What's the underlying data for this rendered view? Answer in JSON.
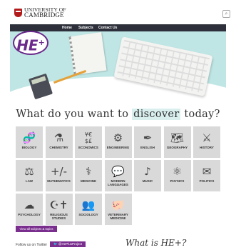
{
  "header": {
    "logo_line1": "UNIVERSITY OF",
    "logo_line2": "CAMBRIDGE",
    "search_icon": "search-icon"
  },
  "nav": {
    "items": [
      "Home",
      "Subjects",
      "Contact Us"
    ]
  },
  "badge": {
    "text": "HE",
    "sup": "+"
  },
  "tagline": {
    "before": "What do you want to",
    "highlight": "discover",
    "after": "today?"
  },
  "subjects": [
    {
      "label": "Biology",
      "icon": "dna-icon",
      "glyph": "🧬"
    },
    {
      "label": "Chemistry",
      "icon": "molecule-icon",
      "glyph": "⚗"
    },
    {
      "label": "Economics",
      "icon": "currency-icon",
      "glyph": "¥€\n$£"
    },
    {
      "label": "Engineering",
      "icon": "gears-icon",
      "glyph": "⚙"
    },
    {
      "label": "English",
      "icon": "book-pen-icon",
      "glyph": "✒"
    },
    {
      "label": "Geography",
      "icon": "world-map-icon",
      "glyph": "🗺"
    },
    {
      "label": "History",
      "icon": "battle-icon",
      "glyph": "⚔"
    },
    {
      "label": "Law",
      "icon": "scales-icon",
      "glyph": "⚖"
    },
    {
      "label": "Mathematics",
      "icon": "plus-minus-icon",
      "glyph": "+/-"
    },
    {
      "label": "Medicine",
      "icon": "stethoscope-icon",
      "glyph": "⚕"
    },
    {
      "label": "Modern Languages",
      "icon": "speech-bubbles-icon",
      "glyph": "💬"
    },
    {
      "label": "Music",
      "icon": "music-note-icon",
      "glyph": "♪"
    },
    {
      "label": "Physics",
      "icon": "atom-icon",
      "glyph": "⚛"
    },
    {
      "label": "Politics",
      "icon": "ballot-icon",
      "glyph": "✉"
    },
    {
      "label": "Psychology",
      "icon": "brain-icon",
      "glyph": "☁"
    },
    {
      "label": "Religious Studies",
      "icon": "religious-symbols-icon",
      "glyph": "☪✝"
    },
    {
      "label": "Sociology",
      "icon": "people-icon",
      "glyph": "👥"
    },
    {
      "label": "Veterinary Medicine",
      "icon": "pig-icon",
      "glyph": "🐖"
    }
  ],
  "view_all": "View all subjects & topics",
  "footer": {
    "follow": "Follow us on Twitter",
    "twitter_handle": "@HePlusProject",
    "what_is": "What is HE+?"
  },
  "colors": {
    "accent": "#7a2f8f",
    "hero_bg": "#bfe6e4",
    "tile_bg": "#d9d9d9",
    "nav_bg": "#2d2f3a"
  }
}
